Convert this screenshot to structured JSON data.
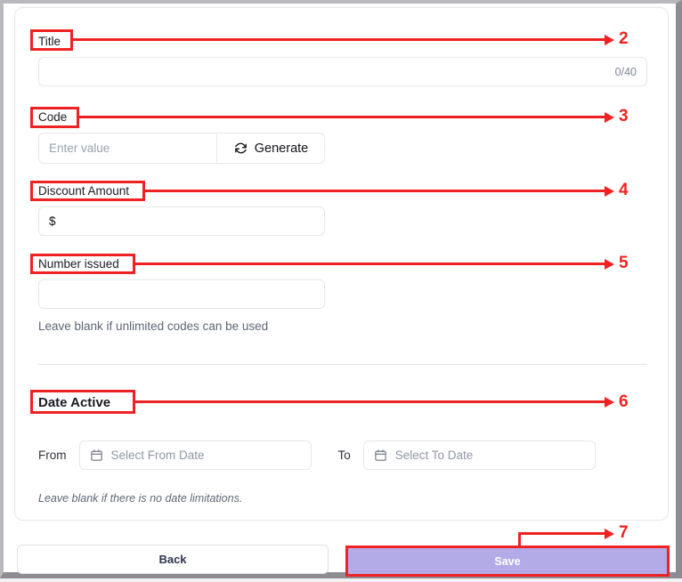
{
  "form": {
    "title_field": {
      "label": "Title",
      "value": "",
      "placeholder": "",
      "counter": "0/40"
    },
    "code_field": {
      "label": "Code",
      "value": "",
      "placeholder": "Enter value",
      "generate_label": "Generate",
      "generate_icon": "refresh-icon"
    },
    "discount_field": {
      "label": "Discount Amount",
      "prefix": "$",
      "value": ""
    },
    "number_issued_field": {
      "label": "Number issued",
      "value": "",
      "helper": "Leave blank if unlimited codes can be used"
    },
    "date_active": {
      "heading": "Date Active",
      "from_label": "From",
      "from_placeholder": "Select From Date",
      "from_value": "",
      "to_label": "To",
      "to_placeholder": "Select To Date",
      "to_value": "",
      "helper": "Leave blank if there is no date limitations.",
      "calendar_icon": "calendar-icon"
    }
  },
  "footer": {
    "back_label": "Back",
    "save_label": "Save"
  },
  "annotations": {
    "markers": [
      {
        "number": "2",
        "target": "Title"
      },
      {
        "number": "3",
        "target": "Code"
      },
      {
        "number": "4",
        "target": "Discount Amount"
      },
      {
        "number": "5",
        "target": "Number issued"
      },
      {
        "number": "6",
        "target": "Date Active"
      },
      {
        "number": "7",
        "target": "Save"
      }
    ],
    "color": "#ee2222"
  },
  "colors": {
    "save_button_bg": "#b3aae8",
    "save_button_text": "#ffffff",
    "annotation_red": "#ee2222",
    "input_border": "#e7e7ec",
    "card_bg": "#ffffff"
  }
}
